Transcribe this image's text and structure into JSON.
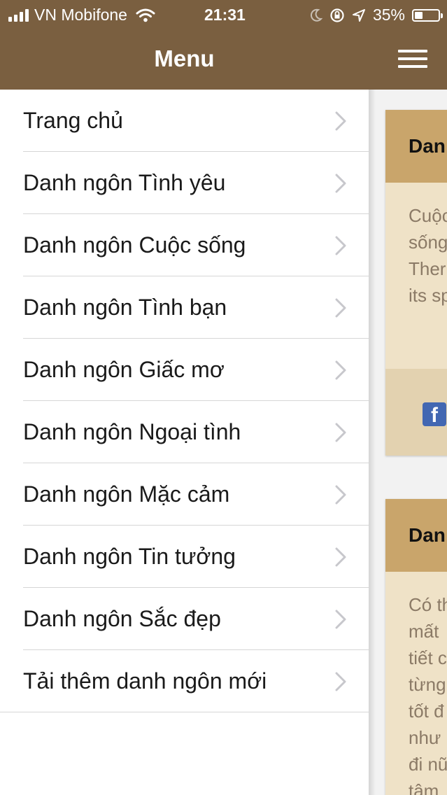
{
  "status_bar": {
    "carrier": "VN Mobifone",
    "time": "21:31",
    "battery_percent": "35%",
    "battery_level": 0.35,
    "icons": [
      "signal-icon",
      "wifi-icon",
      "moon-icon",
      "orientation-lock-icon",
      "location-arrow-icon",
      "battery-icon"
    ]
  },
  "menu": {
    "title": "Menu",
    "items": [
      {
        "label": "Trang chủ"
      },
      {
        "label": "Danh ngôn Tình yêu"
      },
      {
        "label": "Danh ngôn Cuộc sống"
      },
      {
        "label": "Danh ngôn Tình bạn"
      },
      {
        "label": "Danh ngôn Giấc mơ"
      },
      {
        "label": "Danh ngôn Ngoại tình"
      },
      {
        "label": "Danh ngôn Mặc cảm"
      },
      {
        "label": "Danh ngôn Tin tưởng"
      },
      {
        "label": "Danh ngôn Sắc đẹp"
      },
      {
        "label": "Tải thêm danh ngôn mới"
      }
    ]
  },
  "content": {
    "cards": [
      {
        "title": "Dan",
        "lines": [
          "Cuộc",
          "sống",
          "Ther",
          "its sp"
        ],
        "share_icon": "facebook-icon",
        "share_glyph": "f"
      },
      {
        "title": "Dan",
        "lines": [
          "Có th",
          "mất",
          "tiết c",
          "từng",
          "tốt đ",
          "như",
          "đi nũ",
          "tâm"
        ]
      }
    ]
  },
  "colors": {
    "header_brown": "#7a5f40",
    "card_header": "#c9a56b",
    "card_body": "#efe2c7",
    "card_footer": "#e3d2b0",
    "facebook_blue": "#4267b2"
  }
}
